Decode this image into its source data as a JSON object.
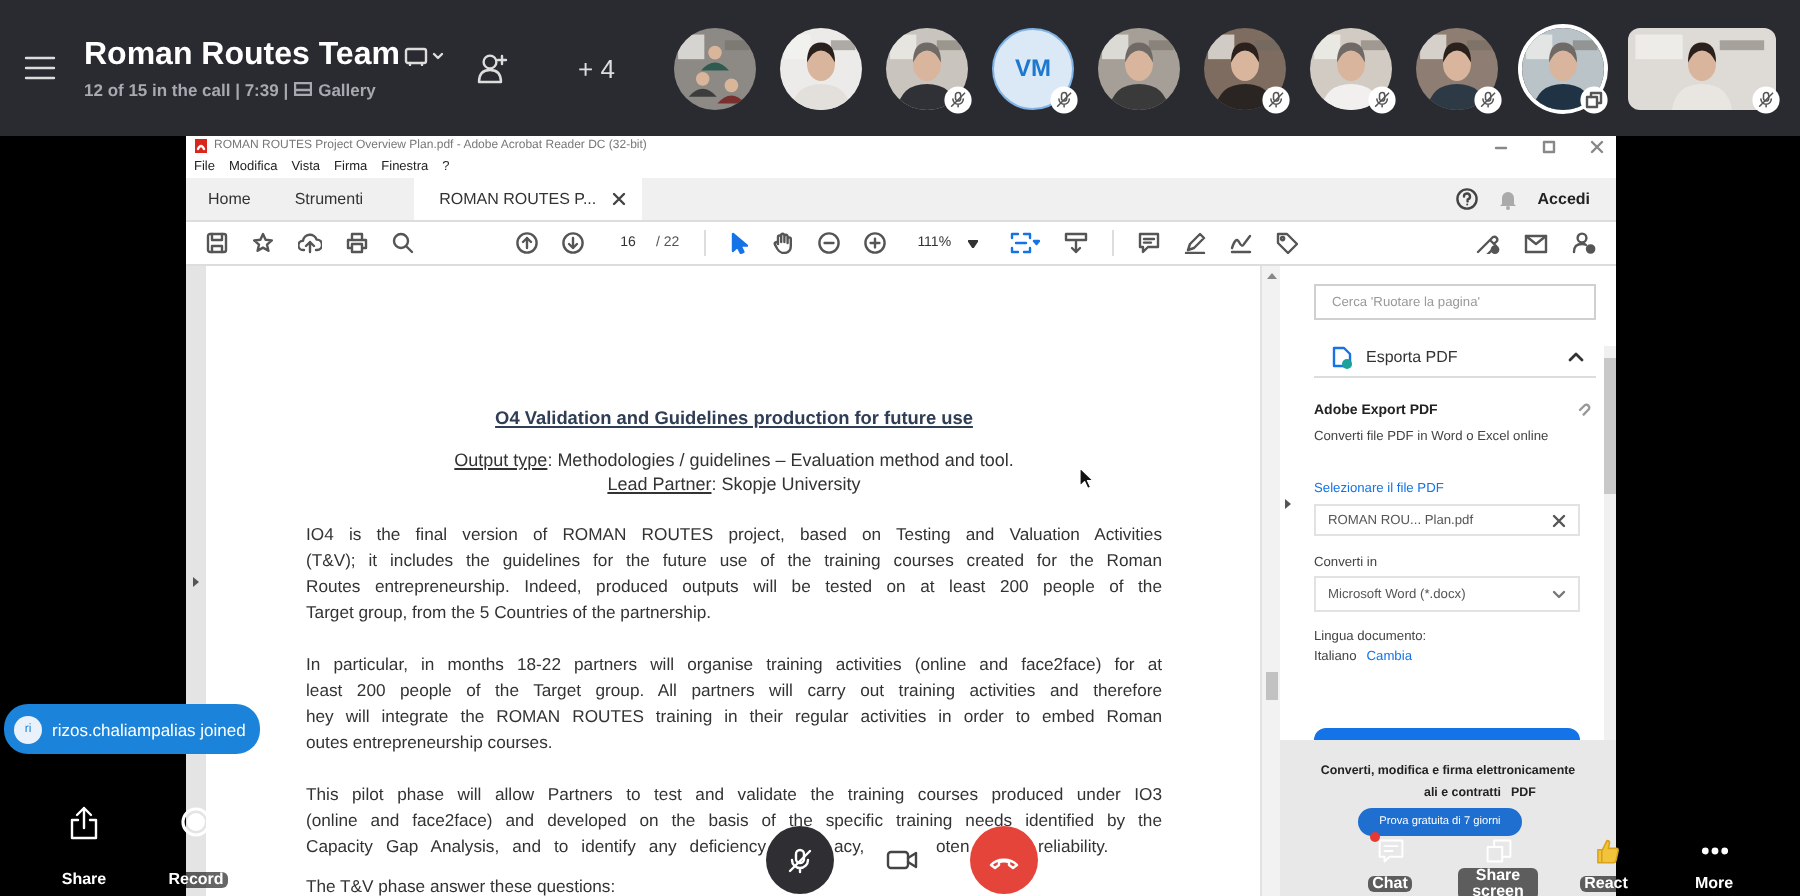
{
  "call": {
    "title": "Roman Routes Team",
    "status": "12 of 15 in the call | 7:39 |",
    "view": "Gallery",
    "extra_count": "+ 4"
  },
  "participants": [
    {
      "kind": "video",
      "speaking": false,
      "muted": false,
      "popped_out": false
    },
    {
      "kind": "video",
      "speaking": false,
      "muted": false,
      "popped_out": false
    },
    {
      "kind": "video",
      "speaking": false,
      "muted": true,
      "popped_out": false
    },
    {
      "kind": "avatar",
      "initials": "VM",
      "speaking": false,
      "muted": true,
      "popped_out": false
    },
    {
      "kind": "video",
      "speaking": false,
      "muted": false,
      "popped_out": false
    },
    {
      "kind": "video",
      "speaking": false,
      "muted": true,
      "popped_out": false
    },
    {
      "kind": "video",
      "speaking": false,
      "muted": true,
      "popped_out": false
    },
    {
      "kind": "video",
      "speaking": false,
      "muted": true,
      "popped_out": false
    },
    {
      "kind": "video",
      "speaking": true,
      "muted": false,
      "popped_out": true
    },
    {
      "kind": "video-wide",
      "speaking": false,
      "muted": true,
      "popped_out": false
    }
  ],
  "acrobat": {
    "title": "ROMAN ROUTES Project Overview Plan.pdf - Adobe Acrobat Reader DC (32-bit)",
    "menu": [
      "File",
      "Modifica",
      "Vista",
      "Firma",
      "Finestra",
      "?"
    ],
    "tabs": [
      {
        "label": "Home",
        "selected": false,
        "closable": false
      },
      {
        "label": "Strumenti",
        "selected": false,
        "closable": false
      },
      {
        "label": "ROMAN ROUTES P...",
        "selected": true,
        "closable": true
      }
    ],
    "sign_in": "Accedi",
    "page": "16",
    "page_count": "/ 22",
    "zoom": "111%"
  },
  "document": {
    "heading": "O4 Validation and Guidelines production for future use",
    "meta": [
      {
        "label": "Output type",
        "text": ": Methodologies / guidelines – Evaluation method and tool."
      },
      {
        "label": "Lead Partner",
        "text": ": Skopje University"
      }
    ],
    "paragraphs": [
      {
        "lines": [
          "IO4 is the final version of ROMAN ROUTES project, based on Testing and Valuation Activities",
          "(T&V); it includes the guidelines for the future use of the training courses created for the Roman",
          "Routes entrepreneurship. Indeed, produced outputs will be tested on at least 200 people of the",
          "Target group, from the 5 Countries of the partnership."
        ]
      },
      {
        "lines": [
          "In particular, in months 18-22 partners will organise training activities (online and face2face) for at",
          "least 200 people of the Target group. All partners will carry out training activities and therefore",
          "hey will integrate the ROMAN ROUTES training in their regular activities in order to embed Roman",
          "outes entrepreneurship courses."
        ]
      },
      {
        "lines": [
          "This pilot phase will allow Partners to test and validate the training courses produced under IO3",
          "(online and face2face) and developed on the basis of the specific training needs identified by the",
          [
            "Capacity Gap Analysis, and to identify any deficiency",
            "acy,",
            "oten",
            "reliability."
          ]
        ]
      },
      {
        "lines": [
          "The T&V phase answer these questions:"
        ]
      }
    ]
  },
  "export_panel": {
    "search_placeholder": "Cerca 'Ruotare la pagina'",
    "section": "Esporta PDF",
    "expanded": true,
    "service": "Adobe Export PDF",
    "description": "Converti file PDF in Word o Excel online",
    "file_label": "Selezionare il file PDF",
    "file": "ROMAN ROU... Plan.pdf",
    "convert_label": "Converti in",
    "format": "Microsoft Word (*.docx)",
    "language_label": "Lingua documento:",
    "language": "Italiano",
    "change_link": "Cambia",
    "promo_lines": [
      [
        "Converti, modifica e firma elettronicamente"
      ],
      [
        "ali e contratti",
        "PDF"
      ]
    ],
    "trial_button": "Prova gratuita di 7 giorni"
  },
  "toast": {
    "initials": "ri",
    "text": "rizos.chaliampalias joined"
  },
  "left_controls": [
    {
      "kind": "share",
      "label": "Share"
    },
    {
      "kind": "record",
      "label": "Record"
    }
  ],
  "call_controls": [
    {
      "kind": "mic",
      "muted": true
    },
    {
      "kind": "camera"
    },
    {
      "kind": "hangup"
    }
  ],
  "right_controls": [
    {
      "kind": "chat",
      "label": "Chat",
      "unread": true
    },
    {
      "kind": "share-screen",
      "label": "Share screen"
    },
    {
      "kind": "react",
      "label": "React"
    },
    {
      "kind": "more",
      "label": "More"
    }
  ]
}
